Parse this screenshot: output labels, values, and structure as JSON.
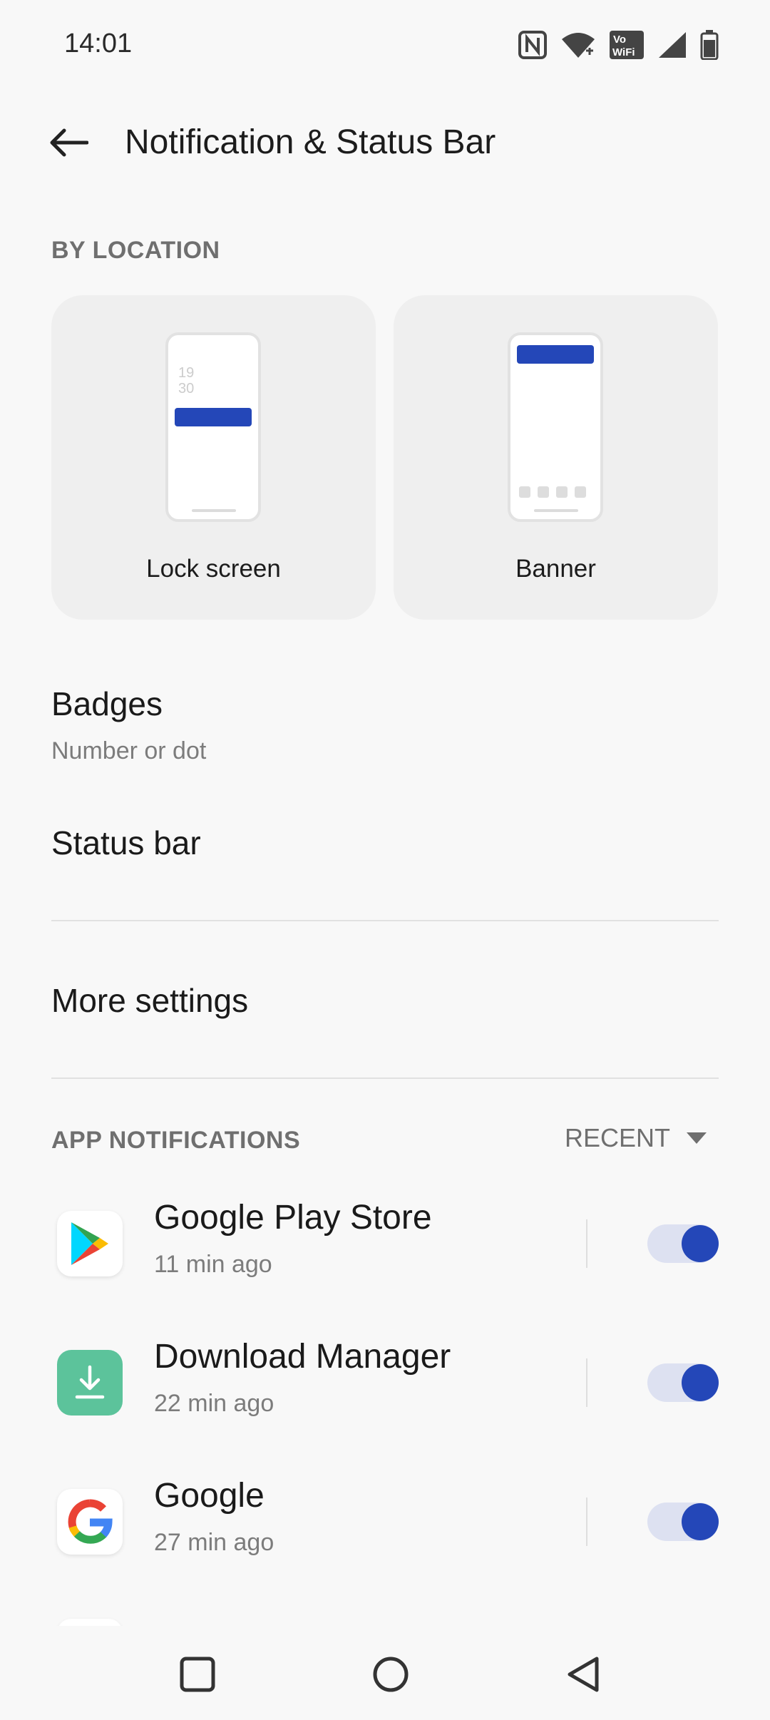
{
  "status_bar": {
    "time": "14:01",
    "icons": [
      "nfc-icon",
      "wifi-icon",
      "vowifi-icon",
      "signal-icon",
      "battery-icon"
    ]
  },
  "header": {
    "back_icon": "arrow-left-icon",
    "title": "Notification & Status Bar"
  },
  "by_location": {
    "label": "BY LOCATION",
    "cards": [
      {
        "label": "Lock screen",
        "preview_clock": [
          "19",
          "30"
        ]
      },
      {
        "label": "Banner"
      }
    ]
  },
  "badges": {
    "title": "Badges",
    "subtitle": "Number or dot"
  },
  "status_bar_row": {
    "title": "Status bar"
  },
  "more_settings": {
    "title": "More settings"
  },
  "app_notifications": {
    "label": "APP NOTIFICATIONS",
    "sort": "RECENT",
    "apps": [
      {
        "name": "Google Play Store",
        "time": "11 min ago",
        "enabled": true
      },
      {
        "name": "Download Manager",
        "time": "22 min ago",
        "enabled": true
      },
      {
        "name": "Google",
        "time": "27 min ago",
        "enabled": true
      }
    ]
  },
  "colors": {
    "accent": "#2447b8",
    "toggle_track": "#dde1f1",
    "card_bg": "#efefef",
    "download_icon_bg": "#5cc39b"
  },
  "nav_bar": {
    "buttons": [
      "recents-square-icon",
      "home-circle-icon",
      "back-triangle-icon"
    ]
  }
}
